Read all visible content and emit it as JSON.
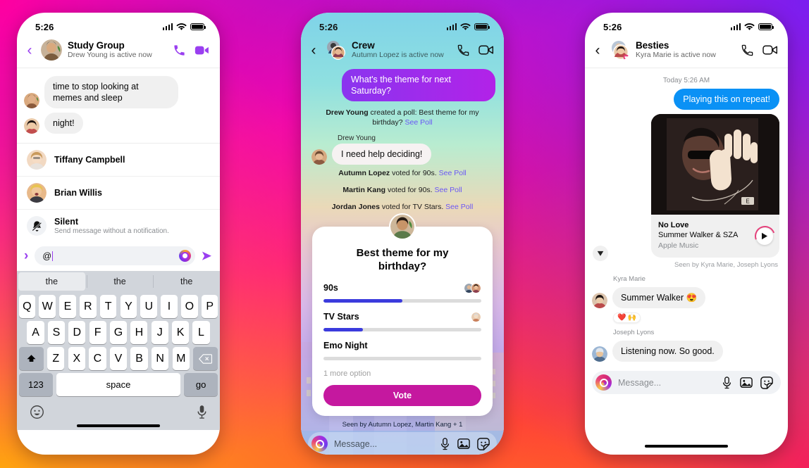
{
  "background": {
    "gradient_colors": [
      "#ff00a0",
      "#7a1ef0",
      "#ffb400",
      "#ff1f4b"
    ]
  },
  "phones": [
    {
      "id": "phone-1",
      "status_bar": {
        "time": "5:26",
        "signal_icon": "cellular-bars-icon",
        "wifi_icon": "wifi-icon",
        "battery_icon": "battery-full-icon"
      },
      "header": {
        "back_icon": "chevron-left-icon",
        "title": "Study Group",
        "subtitle": "Drew Young is active now",
        "call_icon": "phone-call-icon",
        "video_icon": "video-camera-icon",
        "accent": "#9a3ff0"
      },
      "messages": [
        {
          "sender": "avatar-1",
          "text": "time to stop looking at memes and sleep"
        },
        {
          "sender": "avatar-2",
          "text": "night!"
        }
      ],
      "mention_list": [
        {
          "name": "Tiffany Campbell",
          "sub": ""
        },
        {
          "name": "Brian Willis",
          "sub": ""
        },
        {
          "name": "Silent",
          "sub": "Send message without a notification.",
          "icon": "bell-slash-icon"
        }
      ],
      "composer": {
        "expand_icon": "chevron-right-icon",
        "value": "@",
        "camera_icon": "instagram-camera-icon",
        "send_icon": "send-arrow-icon"
      },
      "keyboard": {
        "suggestions": [
          "the",
          "the",
          "the"
        ],
        "row1": [
          "Q",
          "W",
          "E",
          "R",
          "T",
          "Y",
          "U",
          "I",
          "O",
          "P"
        ],
        "row2": [
          "A",
          "S",
          "D",
          "F",
          "G",
          "H",
          "J",
          "K",
          "L"
        ],
        "row3": [
          "Z",
          "X",
          "C",
          "V",
          "B",
          "N",
          "M"
        ],
        "shift_icon": "shift-up-icon",
        "backspace_icon": "backspace-icon",
        "numbers_key": "123",
        "space_key": "space",
        "return_key": "go",
        "emoji_icon": "emoji-smiley-icon",
        "mic_icon": "microphone-icon"
      }
    },
    {
      "id": "phone-2",
      "status_bar": {
        "time": "5:26",
        "signal_icon": "cellular-bars-icon",
        "wifi_icon": "wifi-icon",
        "battery_icon": "battery-full-icon"
      },
      "header": {
        "back_icon": "chevron-left-icon",
        "title": "Crew",
        "subtitle": "Autumn Lopez is active now",
        "call_icon": "phone-call-icon",
        "video_icon": "video-camera-icon"
      },
      "outgoing_message": "What's the theme for next Saturday?",
      "poll_created": {
        "actor": "Drew Young",
        "text": " created a poll: Best theme for my birthday? ",
        "link": "See Poll"
      },
      "reply": {
        "sender_label": "Drew Young",
        "text": "I need help deciding!"
      },
      "votes": [
        {
          "actor": "Autumn Lopez",
          "text": " voted for 90s. ",
          "link": "See Poll"
        },
        {
          "actor": "Martin Kang",
          "text": " voted for 90s. ",
          "link": "See Poll"
        },
        {
          "actor": "Jordan Jones",
          "text": " voted for TV Stars. ",
          "link": "See Poll"
        }
      ],
      "poll_card": {
        "question": "Best theme for my birthday?",
        "options": [
          {
            "label": "90s",
            "percent": 50,
            "voters": 2
          },
          {
            "label": "TV Stars",
            "percent": 25,
            "voters": 1
          },
          {
            "label": "Emo Night",
            "percent": 0,
            "voters": 0
          }
        ],
        "more_option": "1 more option",
        "vote_button": "Vote",
        "bar_color": "#3b3bdd",
        "button_color": "#c5189f"
      },
      "seen_by": "Seen by Autumn Lopez, Martin Kang + 1",
      "composer": {
        "camera_icon": "instagram-camera-icon",
        "placeholder": "Message...",
        "mic_icon": "microphone-icon",
        "gallery_icon": "photo-gallery-icon",
        "sticker_icon": "sticker-smiley-icon"
      }
    },
    {
      "id": "phone-3",
      "status_bar": {
        "time": "5:26",
        "signal_icon": "cellular-bars-icon",
        "wifi_icon": "wifi-icon",
        "battery_icon": "battery-full-icon"
      },
      "header": {
        "back_icon": "chevron-left-icon",
        "title": "Besties",
        "subtitle": "Kyra Marie is active now",
        "call_icon": "phone-call-icon",
        "video_icon": "video-camera-icon"
      },
      "timestamp": "Today 5:26 AM",
      "outgoing_message": "Playing this on repeat!",
      "music_card": {
        "title": "No Love",
        "artist": "Summer Walker & SZA",
        "source": "Apple Music",
        "play_icon": "play-triangle-icon",
        "explicit_badge": "E"
      },
      "seen_by": "Seen by Kyra Marie, Joseph Lyons",
      "scroll_down_icon": "chevron-down-circle-icon",
      "messages": [
        {
          "sender_label": "Kyra Marie",
          "text": "Summer Walker 😍",
          "reactions": [
            "❤️",
            "🙌"
          ]
        },
        {
          "sender_label": "Joseph Lyons",
          "text": "Listening now. So good."
        }
      ],
      "composer": {
        "camera_icon": "instagram-camera-icon",
        "placeholder": "Message...",
        "mic_icon": "microphone-icon",
        "gallery_icon": "photo-gallery-icon",
        "sticker_icon": "sticker-smiley-icon"
      }
    }
  ]
}
